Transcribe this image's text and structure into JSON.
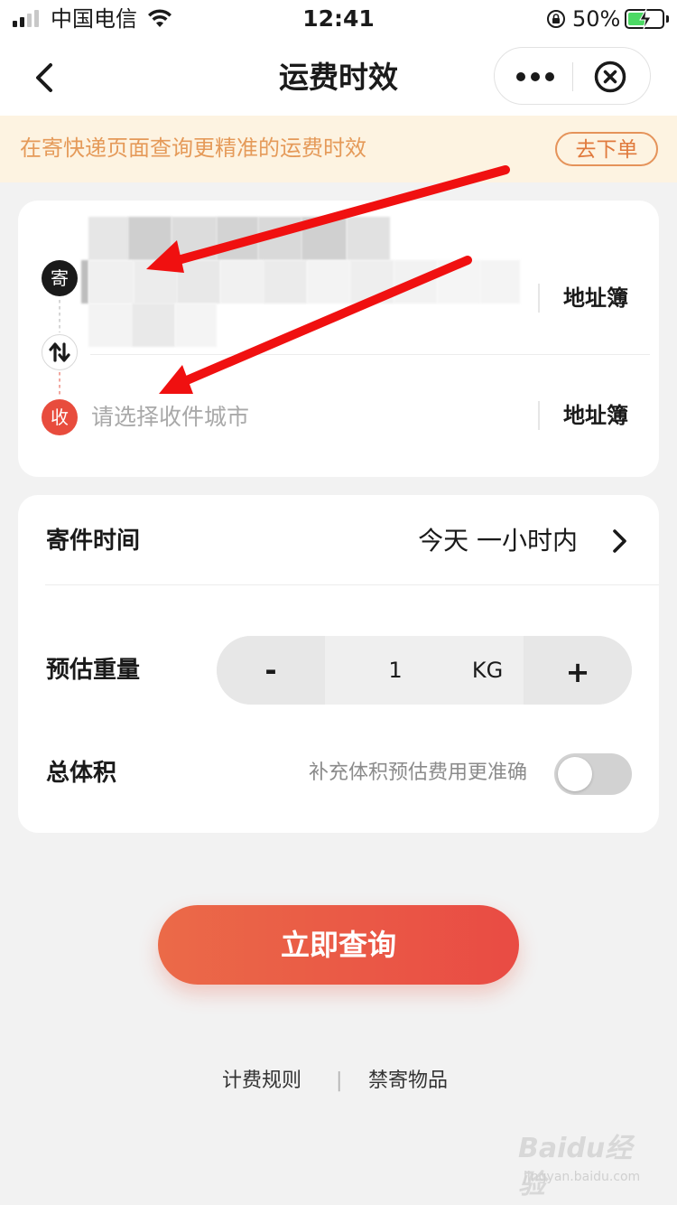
{
  "status_bar": {
    "carrier": "中国电信",
    "time": "12:41",
    "battery_percent": "50%",
    "battery_level": 0.5,
    "icons": [
      "signal-icon",
      "wifi-icon",
      "orientation-lock-icon",
      "battery-charging-icon"
    ]
  },
  "nav": {
    "title": "运费时效",
    "icons": [
      "back-arrow-icon",
      "more-dots-icon",
      "close-circle-icon"
    ]
  },
  "tip_banner": {
    "text": "在寄快递页面查询更精准的运费时效",
    "button": "去下单"
  },
  "address": {
    "send_badge": "寄",
    "recv_badge": "收",
    "send_book": "地址簿",
    "recv_book": "地址簿",
    "recv_placeholder": "请选择收件城市",
    "swap_icon": "swap-arrows-icon"
  },
  "options": {
    "time_label": "寄件时间",
    "time_value": "今天 一小时内",
    "weight_label": "预估重量",
    "weight_minus": "-",
    "weight_value": "1",
    "weight_unit": "KG",
    "weight_plus": "+",
    "volume_label": "总体积",
    "volume_hint": "补充体积预估费用更准确",
    "volume_toggle_on": false
  },
  "query_button": "立即查询",
  "footer": {
    "rules": "计费规则",
    "separator": "|",
    "banned": "禁寄物品"
  },
  "watermark": {
    "main": "Baidu经验",
    "sub": "jingyan.baidu.com"
  },
  "colors": {
    "accent": "#e94b44",
    "banner_bg": "#fdf3e1",
    "banner_text": "#e59a59",
    "annotation_arrow": "#f01010"
  }
}
